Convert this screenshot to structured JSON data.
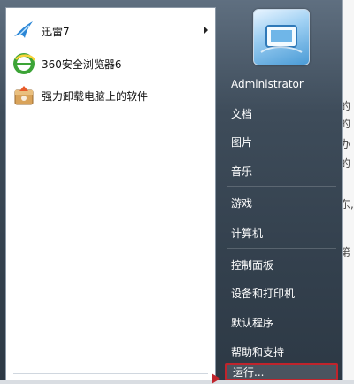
{
  "programs": [
    {
      "label": "迅雷7",
      "icon": "xunlei-bird-icon",
      "has_submenu": true
    },
    {
      "label": "360安全浏览器6",
      "icon": "360-browser-icon",
      "has_submenu": false
    },
    {
      "label": "强力卸载电脑上的软件",
      "icon": "uninstall-box-icon",
      "has_submenu": false
    }
  ],
  "right_pane": {
    "user": "Administrator",
    "links": [
      "文档",
      "图片",
      "音乐",
      "游戏",
      "计算机",
      "控制面板",
      "设备和打印机",
      "默认程序",
      "帮助和支持",
      "运行..."
    ]
  },
  "background_text": [
    "的",
    "的",
    "办",
    "的",
    "东,",
    "第"
  ],
  "colors": {
    "highlight_border": "#c0242c",
    "menu_dark": "#33404d"
  }
}
